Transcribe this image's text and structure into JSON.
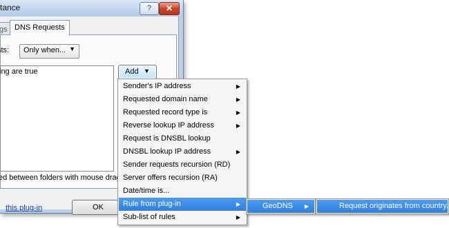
{
  "window": {
    "title": "stance",
    "help_label": "?",
    "close_label": "✕"
  },
  "tabs": {
    "prev_label": "gs",
    "active_label": "DNS Requests"
  },
  "condition": {
    "label": "sts:",
    "selected": "Only when...",
    "arrow": "▼"
  },
  "list": {
    "first_line": "ing are true"
  },
  "add_button": {
    "label": "Add",
    "arrow": "▼"
  },
  "hint": "ed between folders with mouse drag/dr",
  "footer": {
    "link": "this plug-in",
    "ok_label": "OK"
  },
  "main_menu": {
    "items": [
      {
        "label": "Sender's IP address",
        "submenu": true
      },
      {
        "label": "Requested domain name",
        "submenu": true
      },
      {
        "label": "Requested record type is",
        "submenu": true
      },
      {
        "label": "Reverse lookup IP address",
        "submenu": true
      },
      {
        "label": "Request is DNSBL lookup",
        "submenu": false
      },
      {
        "label": "DNSBL lookup IP address",
        "submenu": true
      },
      {
        "label": "Sender requests recursion (RD)",
        "submenu": false
      },
      {
        "label": "Server offers recursion (RA)",
        "submenu": false
      },
      {
        "label": "Date/time is...",
        "submenu": false
      },
      {
        "label": "Rule from plug-in",
        "submenu": true,
        "highlighted": true
      },
      {
        "label": "Sub-list of rules",
        "submenu": true
      }
    ],
    "submenu_arrow": "▶"
  },
  "sub_menu": {
    "items": [
      {
        "label": "GeoDNS",
        "submenu": true,
        "highlighted": true
      }
    ]
  },
  "sub_sub_menu": {
    "items": [
      {
        "label": "Request originates from country...",
        "highlighted": true
      }
    ]
  },
  "colors": {
    "highlight": "#3a8ae6",
    "link": "#0b3fb3",
    "close": "#c9462d"
  }
}
